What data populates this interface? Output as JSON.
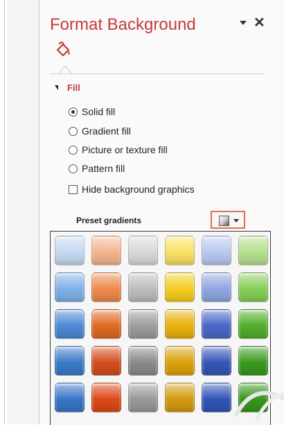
{
  "panel": {
    "title": "Format Background",
    "category_icon": "paint-bucket-icon",
    "fill_section_label": "Fill",
    "fill_options": [
      {
        "label": "Solid fill",
        "selected": true
      },
      {
        "label": "Gradient fill",
        "selected": false
      },
      {
        "label": "Picture or texture fill",
        "selected": false
      },
      {
        "label": "Pattern fill",
        "selected": false
      }
    ],
    "hide_background_graphics": {
      "label": "Hide background graphics",
      "checked": false
    },
    "preset_gradients_label": "Preset gradients"
  },
  "gallery": {
    "rows": [
      [
        "#c4d9f1",
        "#f3b58f",
        "#d8d8d8",
        "#f8e163",
        "#b8c8ee",
        "#b5df8d"
      ],
      [
        "#7fb2e8",
        "#ee8b4c",
        "#bdbdbd",
        "#f4cc1f",
        "#8fa6e1",
        "#86cf57"
      ],
      [
        "#4d8ad6",
        "#e06a24",
        "#9d9d9d",
        "#e9b10c",
        "#4b67c8",
        "#53ae2c"
      ],
      [
        "#3c7ac8",
        "#d24e1f",
        "#8b8b8b",
        "#dba20c",
        "#3656b7",
        "#3a9a1f"
      ],
      [
        "#3a76c7",
        "#dc4a18",
        "#999999",
        "#d49a12",
        "#3155b8",
        "#35961d"
      ]
    ]
  },
  "colors": {
    "title": "#c43b3b",
    "accent_border": "#e36e4c"
  }
}
